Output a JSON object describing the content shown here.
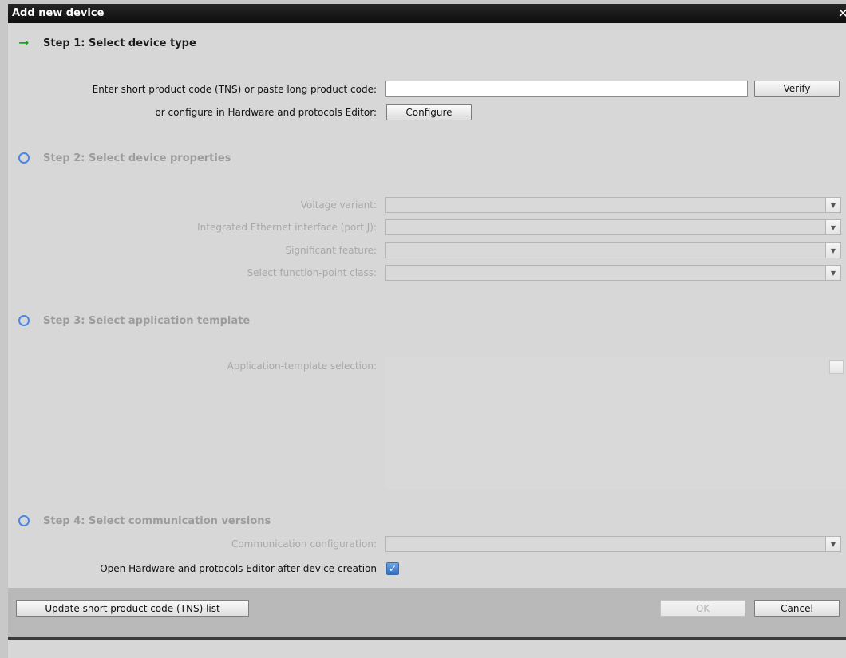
{
  "window": {
    "title": "Add new device",
    "close_glyph": "✕"
  },
  "step1": {
    "title": "Step 1: Select device type",
    "icon": "green-arrow-icon",
    "tns_label": "Enter short product code (TNS) or paste long product code:",
    "tns_value": "",
    "verify_label": "Verify",
    "configure_label": "or configure in Hardware and protocols Editor:",
    "configure_button": "Configure"
  },
  "step2": {
    "title": "Step 2: Select device properties",
    "icon": "circle-icon",
    "fields": [
      {
        "label": "Voltage variant:",
        "value": ""
      },
      {
        "label": "Integrated Ethernet interface (port J):",
        "value": ""
      },
      {
        "label": "Significant feature:",
        "value": ""
      },
      {
        "label": "Select function-point class:",
        "value": ""
      }
    ]
  },
  "step3": {
    "title": "Step 3: Select application template",
    "icon": "circle-icon",
    "template_label": "Application-template selection:"
  },
  "step4": {
    "title": "Step 4: Select communication versions",
    "icon": "circle-icon",
    "comm_label": "Communication configuration:",
    "comm_value": ""
  },
  "options": {
    "open_editor_label": "Open Hardware and protocols Editor after device creation",
    "open_editor_checked": true
  },
  "footer": {
    "update_label": "Update short product code (TNS) list",
    "ok_label": "OK",
    "cancel_label": "Cancel"
  },
  "colors": {
    "accent": "#4a86e8",
    "active_arrow": "#1aa31a",
    "titlebar": "#1a1a1a"
  }
}
